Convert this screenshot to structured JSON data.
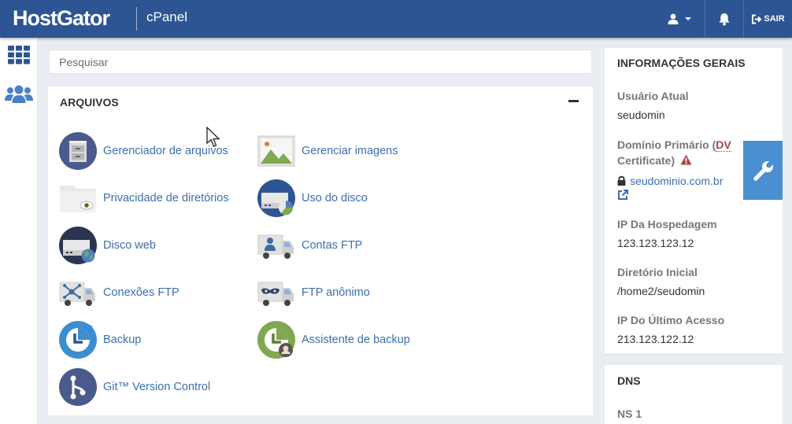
{
  "header": {
    "brand": "HostGator",
    "product": "cPanel",
    "logout_label": "SAIR"
  },
  "search": {
    "placeholder": "Pesquisar"
  },
  "files_section": {
    "title": "ARQUIVOS",
    "tools": [
      {
        "label": "Gerenciador de arquivos",
        "icon": "file-cabinet-icon"
      },
      {
        "label": "Gerenciar imagens",
        "icon": "image-icon"
      },
      {
        "label": "Privacidade de diretórios",
        "icon": "folder-eye-icon"
      },
      {
        "label": "Uso do disco",
        "icon": "disk-usage-icon"
      },
      {
        "label": "Disco web",
        "icon": "web-disk-icon"
      },
      {
        "label": "Contas FTP",
        "icon": "ftp-accounts-icon"
      },
      {
        "label": "Conexões FTP",
        "icon": "ftp-connections-icon"
      },
      {
        "label": "FTP anônimo",
        "icon": "anonymous-ftp-icon"
      },
      {
        "label": "Backup",
        "icon": "backup-icon"
      },
      {
        "label": "Assistente de backup",
        "icon": "backup-wizard-icon"
      },
      {
        "label": "Git™ Version Control",
        "icon": "git-icon"
      }
    ]
  },
  "general_info": {
    "title": "INFORMAÇÕES GERAIS",
    "current_user_label": "Usuário Atual",
    "current_user": "seudomin",
    "primary_domain_label": "Domínio Primário (",
    "dv_label": "DV",
    "certificate_label": "Certificate)",
    "primary_domain": "seudominio.com.br",
    "hosting_ip_label": "IP Da Hospedagem",
    "hosting_ip": "123.123.123.12",
    "home_dir_label": "Diretório Inicial",
    "home_dir": "/home2/seudomin",
    "last_login_ip_label": "IP Do Último Acesso",
    "last_login_ip": "213.123.122.12"
  },
  "dns": {
    "title": "DNS",
    "ns1_label": "NS 1"
  },
  "colors": {
    "header": "#2e5593",
    "link": "#3b6fae",
    "accent_tab": "#4a8fd0",
    "warning": "#a94442"
  }
}
